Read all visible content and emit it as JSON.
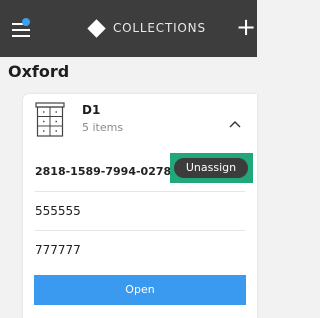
{
  "topbar": {
    "title": "COLLECTIONS",
    "add_label": "+",
    "notification_dot_color": "#3aa0f2",
    "icons": {
      "menu": "hamburger-menu-icon",
      "logo": "diamond-logo-icon",
      "add": "plus-icon"
    }
  },
  "page": {
    "title": "Oxford"
  },
  "collection": {
    "name": "D1",
    "item_count": "5 items",
    "icon": "cabinet-icon",
    "expanded": true,
    "items": [
      {
        "label": "2818-1589-7994-0278-5"
      },
      {
        "label": "555555"
      },
      {
        "label": "777777"
      }
    ],
    "unassign_label": "Unassign",
    "open_label": "Open"
  },
  "colors": {
    "topbar": "#3d3d3d",
    "accent": "#3a9af0",
    "highlight": "#21a77a",
    "background": "#f2f2f2"
  }
}
